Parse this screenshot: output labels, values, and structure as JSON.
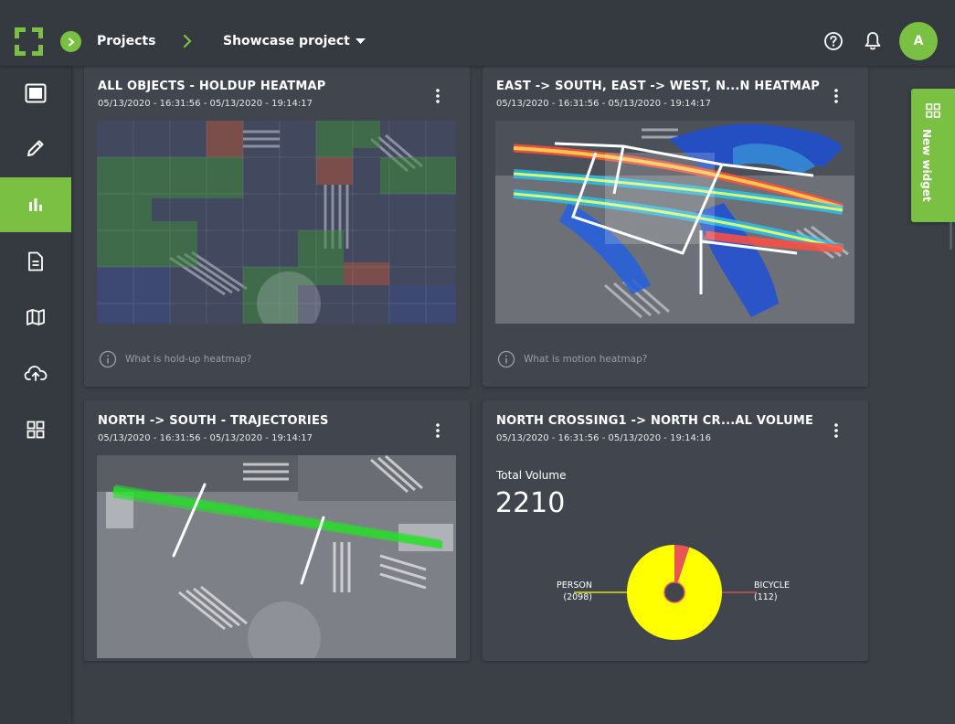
{
  "header": {
    "breadcrumb_projects": "Projects",
    "breadcrumb_current": "Showcase project",
    "avatar_initial": "A"
  },
  "sidebar": {
    "items": [
      {
        "icon": "dashboard-icon"
      },
      {
        "icon": "pencil-icon"
      },
      {
        "icon": "bar-chart-icon",
        "active": true
      },
      {
        "icon": "document-icon"
      },
      {
        "icon": "map-icon"
      },
      {
        "icon": "cloud-upload-icon"
      },
      {
        "icon": "widgets-grid-icon"
      }
    ]
  },
  "widgets": [
    {
      "title": "ALL OBJECTS - HOLDUP HEATMAP",
      "date": "05/13/2020 - 16:31:56 - 05/13/2020 - 19:14:17",
      "info": "What is hold-up heatmap?"
    },
    {
      "title": "EAST -> SOUTH, EAST -> WEST, N...N HEATMAP",
      "date": "05/13/2020 - 16:31:56 - 05/13/2020 - 19:14:17",
      "info": "What is motion heatmap?"
    },
    {
      "title": "NORTH -> SOUTH - TRAJECTORIES",
      "date": "05/13/2020 - 16:31:56 - 05/13/2020 - 19:14:17"
    },
    {
      "title": "NORTH CROSSING1 -> NORTH CR...AL VOLUME",
      "date": "05/13/2020 - 16:31:56 - 05/13/2020 - 19:14:16",
      "volume_label": "Total Volume",
      "volume_value": "2210",
      "person_label": "PERSON",
      "person_count": "(2098)",
      "bicycle_label": "BICYCLE",
      "bicycle_count": "(112)"
    }
  ],
  "chart_data": {
    "type": "pie",
    "categories": [
      "PERSON",
      "BICYCLE"
    ],
    "values": [
      2098,
      112
    ],
    "colors": [
      "#ffff00",
      "#e85555"
    ]
  },
  "new_widget_label": "New widget",
  "colors": {
    "accent": "#7ac143",
    "background": "#3b3f46",
    "card": "#41454d",
    "bar": "#353940"
  }
}
